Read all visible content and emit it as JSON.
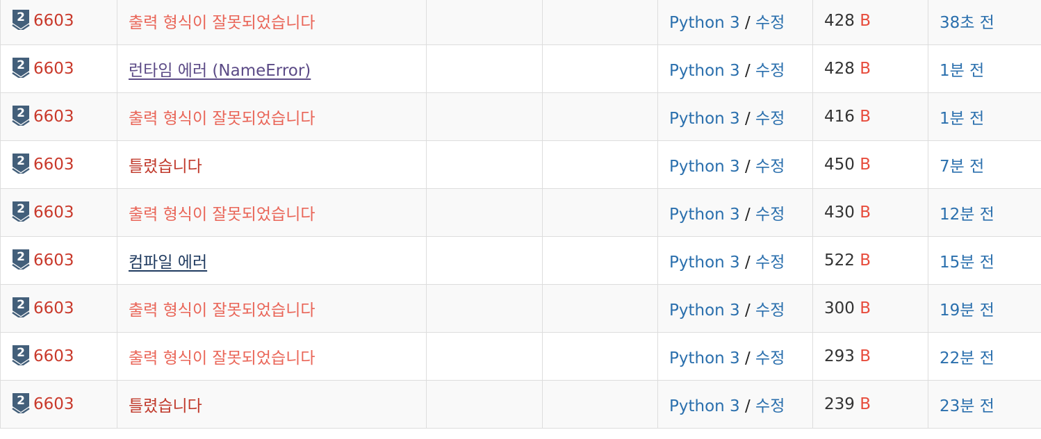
{
  "submissions": [
    {
      "problem": "6603",
      "tier": "2",
      "result": "출력 형식이 잘못되었습니다",
      "result_kind": "pe",
      "language": "Python 3",
      "separator": "/",
      "edit": "수정",
      "code_length": "428",
      "code_unit": "B",
      "submitted": "38초 전"
    },
    {
      "problem": "6603",
      "tier": "2",
      "result": "런타임 에러 (NameError)",
      "result_kind": "rte",
      "language": "Python 3",
      "separator": "/",
      "edit": "수정",
      "code_length": "428",
      "code_unit": "B",
      "submitted": "1분 전"
    },
    {
      "problem": "6603",
      "tier": "2",
      "result": "출력 형식이 잘못되었습니다",
      "result_kind": "pe",
      "language": "Python 3",
      "separator": "/",
      "edit": "수정",
      "code_length": "416",
      "code_unit": "B",
      "submitted": "1분 전"
    },
    {
      "problem": "6603",
      "tier": "2",
      "result": "틀렸습니다",
      "result_kind": "wa",
      "language": "Python 3",
      "separator": "/",
      "edit": "수정",
      "code_length": "450",
      "code_unit": "B",
      "submitted": "7분 전"
    },
    {
      "problem": "6603",
      "tier": "2",
      "result": "출력 형식이 잘못되었습니다",
      "result_kind": "pe",
      "language": "Python 3",
      "separator": "/",
      "edit": "수정",
      "code_length": "430",
      "code_unit": "B",
      "submitted": "12분 전"
    },
    {
      "problem": "6603",
      "tier": "2",
      "result": "컴파일 에러",
      "result_kind": "ce",
      "language": "Python 3",
      "separator": "/",
      "edit": "수정",
      "code_length": "522",
      "code_unit": "B",
      "submitted": "15분 전"
    },
    {
      "problem": "6603",
      "tier": "2",
      "result": "출력 형식이 잘못되었습니다",
      "result_kind": "pe",
      "language": "Python 3",
      "separator": "/",
      "edit": "수정",
      "code_length": "300",
      "code_unit": "B",
      "submitted": "19분 전"
    },
    {
      "problem": "6603",
      "tier": "2",
      "result": "출력 형식이 잘못되었습니다",
      "result_kind": "pe",
      "language": "Python 3",
      "separator": "/",
      "edit": "수정",
      "code_length": "293",
      "code_unit": "B",
      "submitted": "22분 전"
    },
    {
      "problem": "6603",
      "tier": "2",
      "result": "틀렸습니다",
      "result_kind": "wa",
      "language": "Python 3",
      "separator": "/",
      "edit": "수정",
      "code_length": "239",
      "code_unit": "B",
      "submitted": "23분 전"
    }
  ],
  "icons": {
    "tier": "silver-tier-badge-icon"
  },
  "colors": {
    "problem_link": "#c9392b",
    "presentation_error": "#e74c3c",
    "wrong_answer": "#c0392b",
    "runtime_error": "#5b4a86",
    "compile_error": "#1f3a5f",
    "link_blue": "#2a6fad",
    "tier_badge": "#435f7a"
  }
}
